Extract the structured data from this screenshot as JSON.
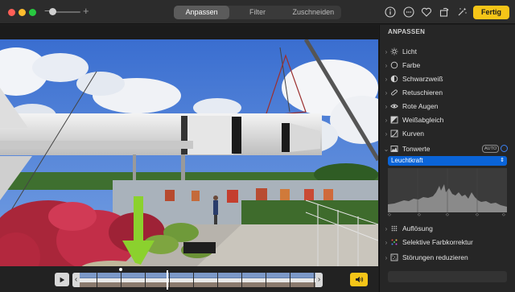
{
  "toolbar": {
    "zoom_minus": "−",
    "zoom_plus": "+",
    "zoom_level": 0.05,
    "tabs": [
      {
        "label": "Anpassen",
        "active": true
      },
      {
        "label": "Filter",
        "active": false
      },
      {
        "label": "Zuschneiden",
        "active": false
      }
    ],
    "icons": [
      "info-icon",
      "emoji-icon",
      "heart-icon",
      "rotate-icon",
      "magic-wand-icon"
    ],
    "done_label": "Fertig",
    "accent_color": "#f5c518"
  },
  "sidebar": {
    "title": "ANPASSEN",
    "items": [
      {
        "label": "Licht",
        "icon": "sun-icon",
        "expanded": false
      },
      {
        "label": "Farbe",
        "icon": "circle-icon",
        "expanded": false
      },
      {
        "label": "Schwarzweiß",
        "icon": "half-circle-icon",
        "expanded": false
      },
      {
        "label": "Retuschieren",
        "icon": "bandage-icon",
        "expanded": false
      },
      {
        "label": "Rote Augen",
        "icon": "eye-icon",
        "expanded": false
      },
      {
        "label": "Weißabgleich",
        "icon": "white-balance-icon",
        "expanded": false
      },
      {
        "label": "Kurven",
        "icon": "curves-icon",
        "expanded": false
      },
      {
        "label": "Tonwerte",
        "icon": "levels-icon",
        "expanded": true
      }
    ],
    "levels": {
      "auto_label": "AUTO",
      "channel": "Leuchtkraft"
    },
    "bottom_items": [
      {
        "label": "Auflösung",
        "icon": "dots-icon"
      },
      {
        "label": "Selektive Farbkorrektur",
        "icon": "color-dots-icon"
      },
      {
        "label": "Störungen reduzieren",
        "icon": "noise-icon"
      }
    ]
  },
  "video": {
    "play_icon": "play-icon",
    "sound_icon": "speaker-icon",
    "left_handle": "‹",
    "right_handle": "›"
  }
}
